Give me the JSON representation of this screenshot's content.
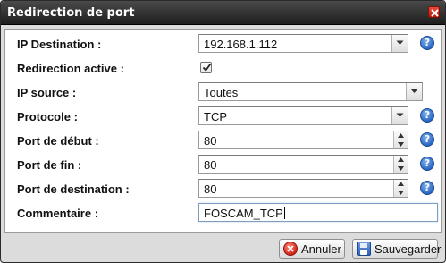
{
  "window": {
    "title": "Redirection de port"
  },
  "form": {
    "ip_destination": {
      "label": "IP Destination :",
      "value": "192.168.1.112"
    },
    "redirection_active": {
      "label": "Redirection active :",
      "checked": true
    },
    "ip_source": {
      "label": "IP source :",
      "value": "Toutes"
    },
    "protocole": {
      "label": "Protocole :",
      "value": "TCP"
    },
    "port_debut": {
      "label": "Port de début :",
      "value": "80"
    },
    "port_fin": {
      "label": "Port de fin :",
      "value": "80"
    },
    "port_destination": {
      "label": "Port de destination :",
      "value": "80"
    },
    "commentaire": {
      "label": "Commentaire :",
      "value": "FOSCAM_TCP"
    }
  },
  "help": {
    "glyph": "?"
  },
  "buttons": {
    "cancel_label": "Annuler",
    "save_label": "Sauvegarder"
  },
  "colors": {
    "titlebar": "#2a2a2a",
    "help_icon": "#2b67c4",
    "cancel_icon": "#d3261a",
    "save_icon": "#2c5fb8"
  }
}
